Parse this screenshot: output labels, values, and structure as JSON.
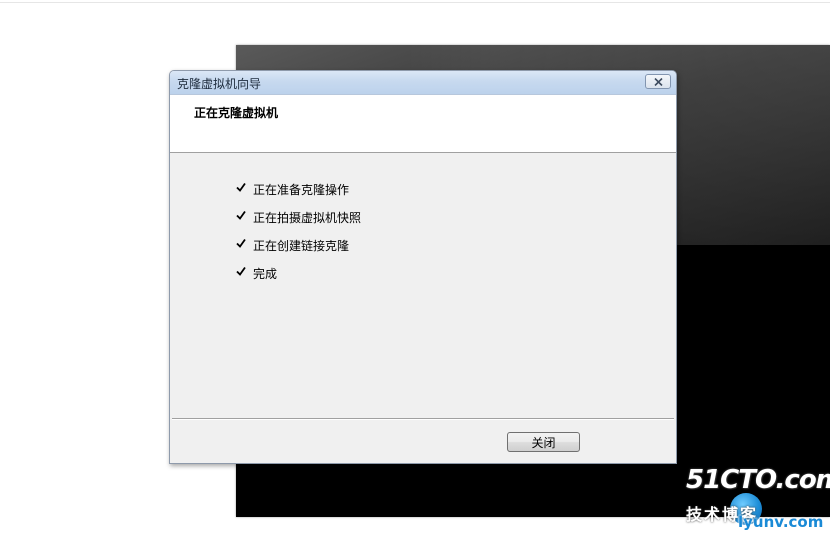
{
  "dialog": {
    "title": "克隆虚拟机向导",
    "heading": "正在克隆虚拟机",
    "steps": [
      {
        "label": "正在准备克隆操作",
        "done": true
      },
      {
        "label": "正在拍摄虚拟机快照",
        "done": true
      },
      {
        "label": "正在创建链接克隆",
        "done": true
      },
      {
        "label": "完成",
        "done": true
      }
    ],
    "close_button_label": "关闭"
  },
  "watermark": {
    "brand": "51CTO.com",
    "tagline": "技术博客",
    "domain": "lyunv.com"
  },
  "colors": {
    "titlebar": "#c7d9ef",
    "dialog_body": "#f0f0f0",
    "console": "#000000"
  },
  "icons": [
    "close-icon",
    "check-icon"
  ]
}
